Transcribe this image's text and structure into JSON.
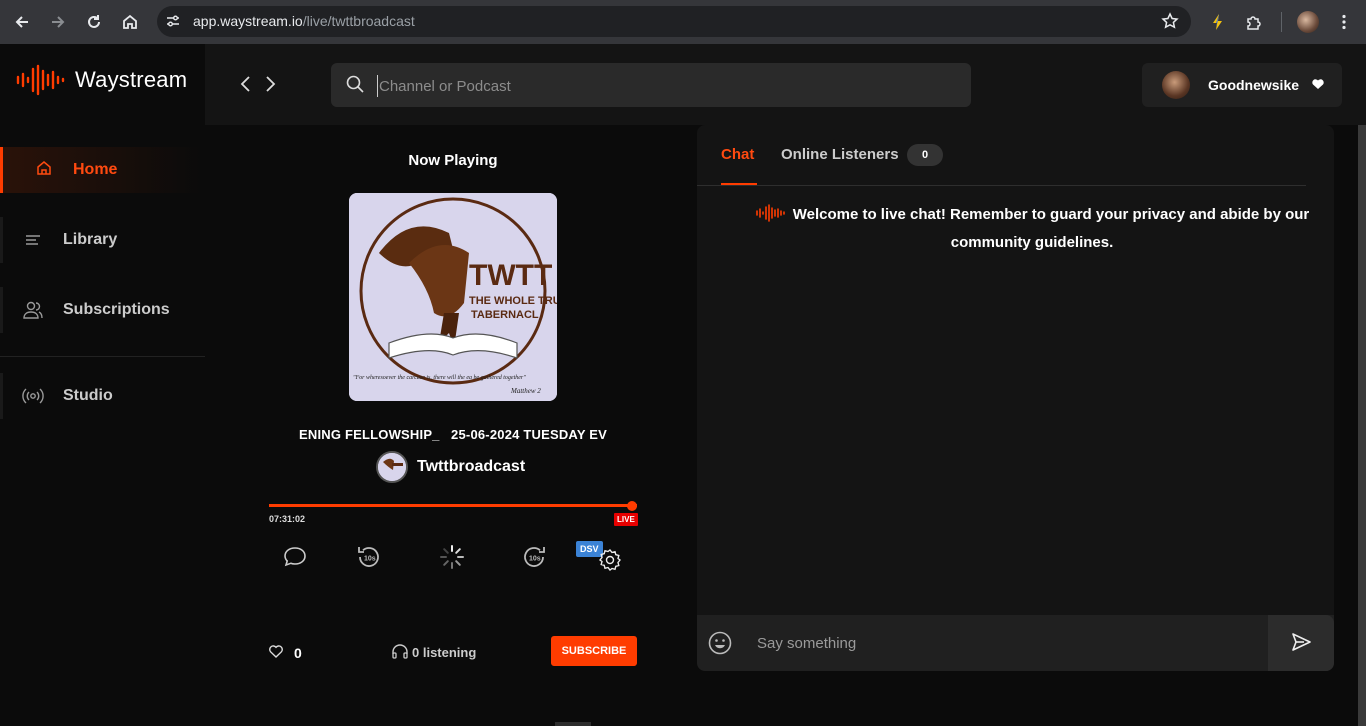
{
  "browser": {
    "url_host": "app.waystream.io",
    "url_path": "/live/twttbroadcast"
  },
  "brand": {
    "name": "Waystream",
    "accent_color": "#ff3c00"
  },
  "sidebar": {
    "items": [
      {
        "label": "Home",
        "icon": "home-icon",
        "active": true
      },
      {
        "label": "Library",
        "icon": "library-icon",
        "active": false
      },
      {
        "label": "Subscriptions",
        "icon": "users-icon",
        "active": false
      },
      {
        "label": "Studio",
        "icon": "broadcast-icon",
        "active": false
      }
    ]
  },
  "search": {
    "placeholder": "Channel or Podcast"
  },
  "user": {
    "name": "Goodnewsike"
  },
  "player": {
    "heading": "Now Playing",
    "cover_text": {
      "title": "TWTT",
      "subtitle1": "THE WHOLE TRU",
      "subtitle2": "TABERNACL",
      "quote": "\"For wheresoever the carcase is, there will the ea be gathered together\"",
      "reference": "Matthew 2"
    },
    "episode_title": "ENING FELLOWSHIP_   25-06-2024 TUESDAY EV",
    "channel": "Twttbroadcast",
    "progress": 1.0,
    "elapsed": "07:31:02",
    "live_badge": "LIVE",
    "dsv_badge": "DSV",
    "likes": "0",
    "listening": "0 listening",
    "subscribe_label": "SUBSCRIBE"
  },
  "chat": {
    "tabs": [
      {
        "label": "Chat",
        "active": true
      },
      {
        "label": "Online Listeners",
        "count": "0"
      }
    ],
    "welcome": "Welcome to live chat! Remember to guard your privacy and abide by our community guidelines.",
    "input_placeholder": "Say something"
  }
}
